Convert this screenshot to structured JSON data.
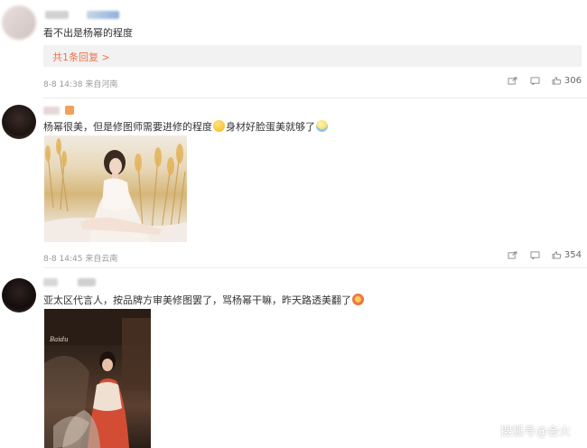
{
  "comments": [
    {
      "text": "看不出是杨幂的程度",
      "reply_link": "共1条回复 >",
      "time": "8-8 14:38",
      "source": "来自河南",
      "likes": "306"
    },
    {
      "text_before": "杨幂很美，但是修图师需要进修的程度",
      "text_after": "身材好脸蛋美就够了",
      "time": "8-8 14:45",
      "source": "来自云南",
      "likes": "354"
    },
    {
      "text": "亚太区代言人，按品牌方审美修图罢了，骂杨幂干嘛，昨天路透美翻了",
      "time": "",
      "source": ""
    }
  ],
  "icons": {
    "share": "share-icon",
    "comment": "comment-icon",
    "like": "like-icon"
  },
  "watermark": "搜狐号@会火",
  "colors": {
    "link": "#eb7350",
    "meta": "#999999",
    "reply_bg": "#f2f2f2"
  }
}
